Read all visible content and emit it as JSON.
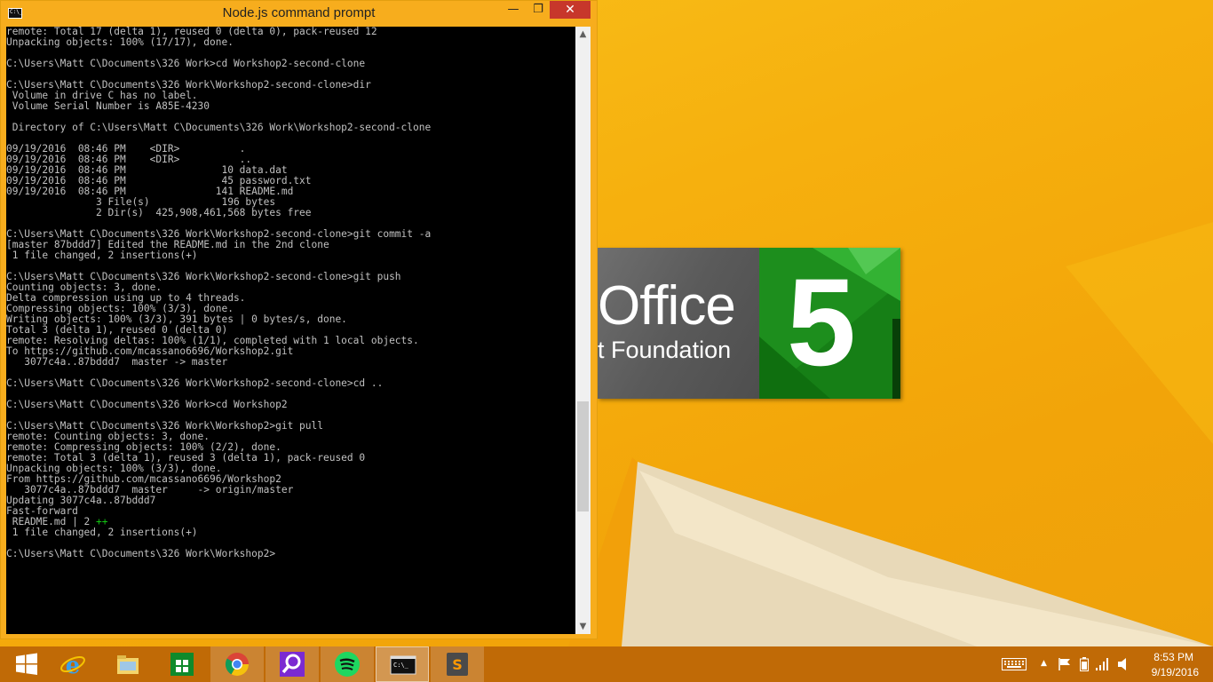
{
  "window": {
    "title": "Node.js command prompt",
    "icon_label": "C:\\_",
    "minimize_glyph": "—",
    "maximize_glyph": "❐",
    "close_glyph": "✕"
  },
  "console": {
    "lines": [
      "remote: Total 17 (delta 1), reused 0 (delta 0), pack-reused 12",
      "Unpacking objects: 100% (17/17), done.",
      "",
      "C:\\Users\\Matt C\\Documents\\326 Work>cd Workshop2-second-clone",
      "",
      "C:\\Users\\Matt C\\Documents\\326 Work\\Workshop2-second-clone>dir",
      " Volume in drive C has no label.",
      " Volume Serial Number is A85E-4230",
      "",
      " Directory of C:\\Users\\Matt C\\Documents\\326 Work\\Workshop2-second-clone",
      "",
      "09/19/2016  08:46 PM    <DIR>          .",
      "09/19/2016  08:46 PM    <DIR>          ..",
      "09/19/2016  08:46 PM                10 data.dat",
      "09/19/2016  08:46 PM                45 password.txt",
      "09/19/2016  08:46 PM               141 README.md",
      "               3 File(s)            196 bytes",
      "               2 Dir(s)  425,908,461,568 bytes free",
      "",
      "C:\\Users\\Matt C\\Documents\\326 Work\\Workshop2-second-clone>git commit -a",
      "[master 87bddd7] Edited the README.md in the 2nd clone",
      " 1 file changed, 2 insertions(+)",
      "",
      "C:\\Users\\Matt C\\Documents\\326 Work\\Workshop2-second-clone>git push",
      "Counting objects: 3, done.",
      "Delta compression using up to 4 threads.",
      "Compressing objects: 100% (3/3), done.",
      "Writing objects: 100% (3/3), 391 bytes | 0 bytes/s, done.",
      "Total 3 (delta 1), reused 0 (delta 0)",
      "remote: Resolving deltas: 100% (1/1), completed with 1 local objects.",
      "To https://github.com/mcassano6696/Workshop2.git",
      "   3077c4a..87bddd7  master -> master",
      "",
      "C:\\Users\\Matt C\\Documents\\326 Work\\Workshop2-second-clone>cd ..",
      "",
      "C:\\Users\\Matt C\\Documents\\326 Work>cd Workshop2",
      "",
      "C:\\Users\\Matt C\\Documents\\326 Work\\Workshop2>git pull",
      "remote: Counting objects: 3, done.",
      "remote: Compressing objects: 100% (2/2), done.",
      "remote: Total 3 (delta 1), reused 3 (delta 1), pack-reused 0",
      "Unpacking objects: 100% (3/3), done.",
      "From https://github.com/mcassano6696/Workshop2",
      "   3077c4a..87bddd7  master     -> origin/master",
      "Updating 3077c4a..87bddd7",
      "Fast-forward",
      " README.md | 2 ",
      " 1 file changed, 2 insertions(+)",
      "",
      "C:\\Users\\Matt C\\Documents\\326 Work\\Workshop2>"
    ],
    "diffstat_plus": "++",
    "diffstat_line_index": 46,
    "text_color": "#c0c0c0",
    "background_color": "#000000",
    "scroll_position": 0.72
  },
  "office_tile": {
    "word": "Office",
    "subtitle": "t Foundation",
    "number": "5"
  },
  "taskbar": {
    "items": [
      {
        "name": "start-button",
        "icon": "windows-logo-icon"
      },
      {
        "name": "internet-explorer",
        "icon": "internet-explorer-icon"
      },
      {
        "name": "file-explorer",
        "icon": "file-explorer-icon"
      },
      {
        "name": "windows-store",
        "icon": "store-icon"
      },
      {
        "name": "chrome",
        "icon": "chrome-icon",
        "state": "active"
      },
      {
        "name": "search-app",
        "icon": "magnifier-icon",
        "state": "active"
      },
      {
        "name": "spotify",
        "icon": "spotify-icon",
        "state": "active"
      },
      {
        "name": "command-prompt",
        "icon": "cmd-icon",
        "state": "running"
      },
      {
        "name": "sublime-text",
        "icon": "sublime-icon",
        "state": "active"
      }
    ],
    "tray": {
      "keyboard_icon": "keyboard-icon",
      "time": "8:53 PM",
      "date": "9/19/2016"
    }
  },
  "colors": {
    "taskbar": "#c06a06",
    "window_frame": "#f7ad1d",
    "close_button": "#c7372b",
    "office_green": "#167f16"
  }
}
